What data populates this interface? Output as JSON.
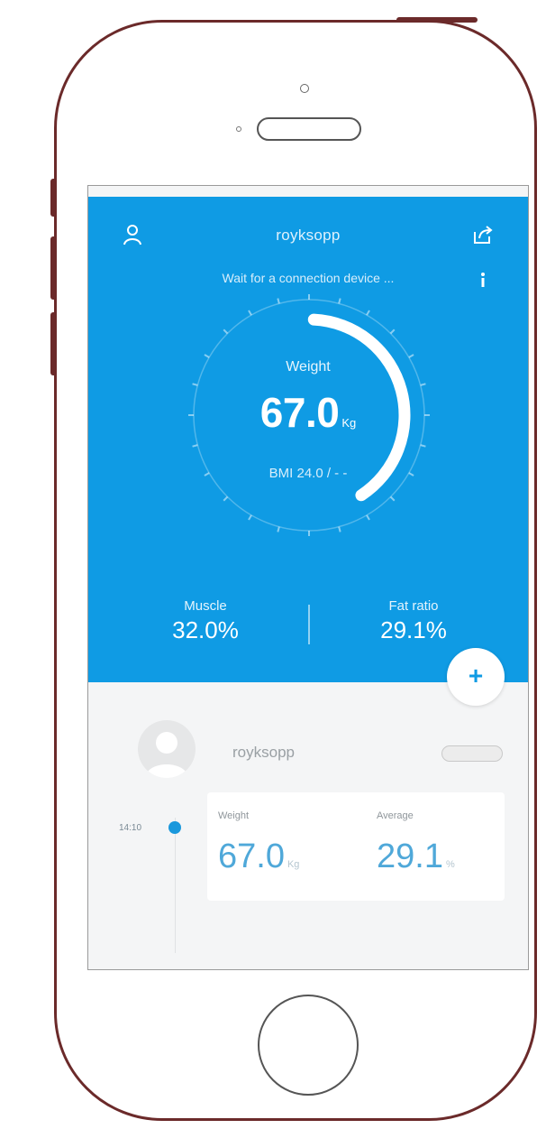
{
  "header": {
    "title": "royksopp",
    "status": "Wait for a connection device ..."
  },
  "gauge": {
    "label": "Weight",
    "value": "67.0",
    "unit": "Kg",
    "bmi": "BMI 24.0 / - -",
    "progress": 0.4
  },
  "stats": {
    "muscle": {
      "label": "Muscle",
      "value": "32.0%"
    },
    "fat": {
      "label": "Fat ratio",
      "value": "29.1%"
    }
  },
  "fab": {
    "label": "+"
  },
  "profile": {
    "name": "royksopp"
  },
  "record": {
    "time": "14:10",
    "weight": {
      "label": "Weight",
      "value": "67.0",
      "unit": "Kg"
    },
    "average": {
      "label": "Average",
      "value": "29.1",
      "unit": "%"
    }
  },
  "colors": {
    "primary": "#0f9be4",
    "frame": "#6b2a2a",
    "accent_text": "#4fa8d9"
  },
  "icons": {
    "user": "user-icon",
    "share": "share-icon",
    "info": "info-icon",
    "add": "plus-icon",
    "avatar": "avatar-placeholder-icon"
  }
}
